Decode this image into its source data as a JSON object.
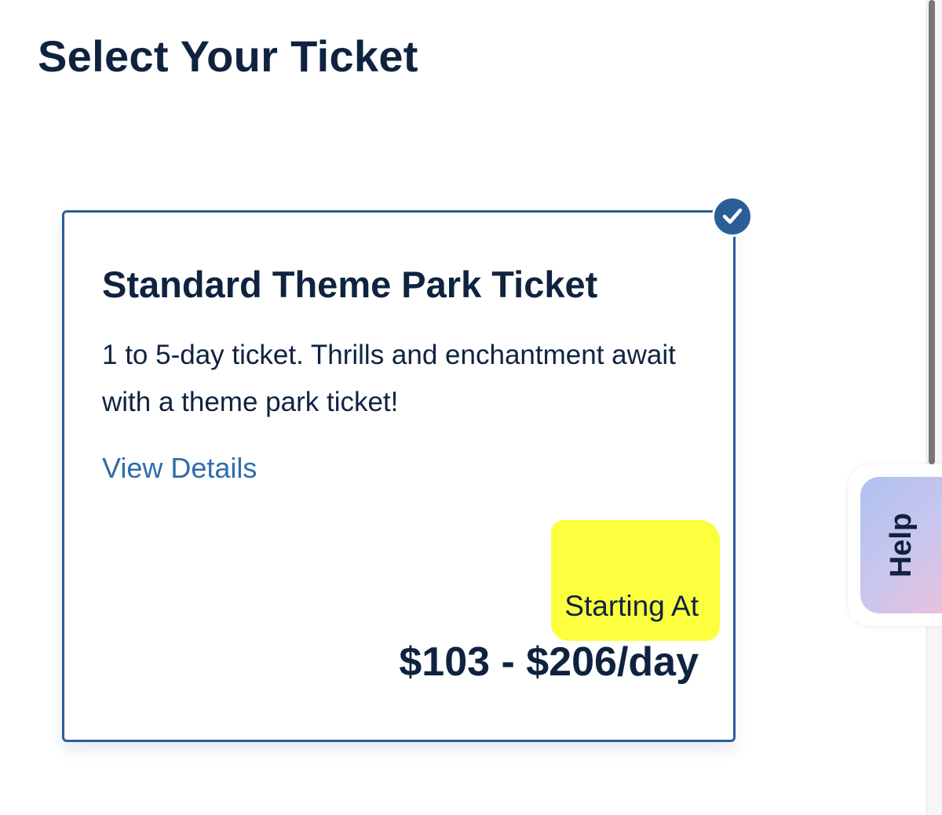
{
  "page": {
    "title": "Select Your Ticket"
  },
  "ticket": {
    "title": "Standard Theme Park Ticket",
    "description": "1 to 5-day ticket. Thrills and enchantment await with a theme park ticket!",
    "details_link": "View Details",
    "starting_label": "Starting At",
    "price_range": "$103 - $206/day",
    "selected": true,
    "selected_icon": "checkmark-icon"
  },
  "help": {
    "label": "Help"
  },
  "colors": {
    "navy_text": "#0f2340",
    "card_border": "#2a5e98",
    "link": "#2f6cab",
    "highlight": "#fbff33"
  }
}
